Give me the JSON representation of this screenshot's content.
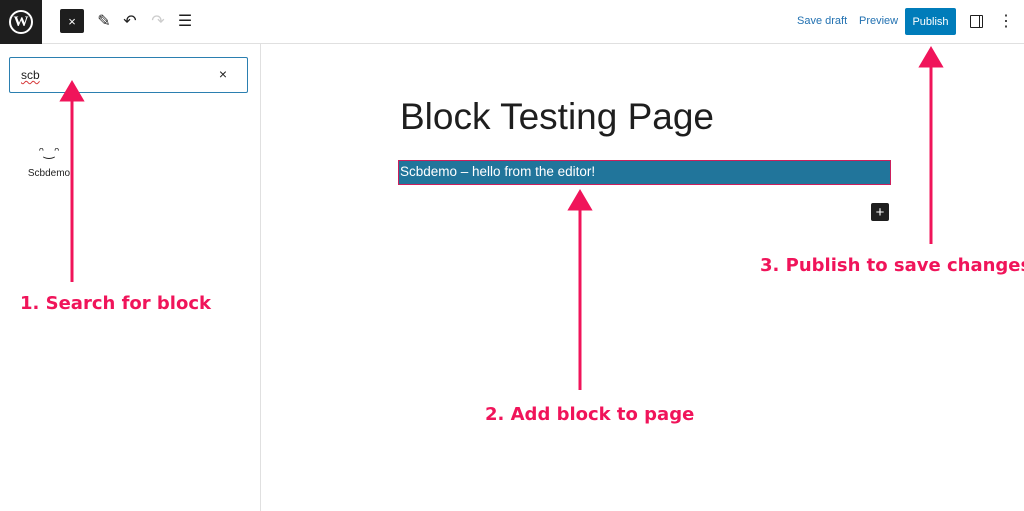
{
  "topbar": {
    "logo": "W",
    "close_icon": "×",
    "save_draft": "Save draft",
    "preview": "Preview",
    "publish": "Publish"
  },
  "sidebar": {
    "search_value": "scb",
    "clear": "×",
    "results": [
      {
        "icon": "smiley-icon",
        "label": "Scbdemo"
      }
    ]
  },
  "editor": {
    "title": "Block Testing Page",
    "paragraph": "Scbdemo – hello from the editor!",
    "add": "+"
  },
  "annotations": {
    "step1": "1. Search for block",
    "step2": "2. Add block to page",
    "step3": "3. Publish to save changes.",
    "color": "#f0145a"
  }
}
